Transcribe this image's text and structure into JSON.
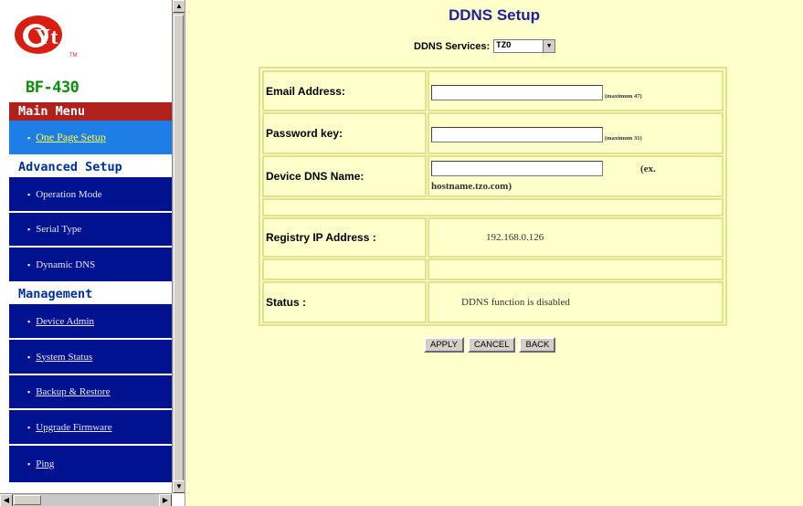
{
  "sidebar": {
    "logo_text": "Yt",
    "logo_tm": "TM",
    "model": "BF-430",
    "main_menu_title": "Main Menu",
    "one_page_setup": "One Page Setup",
    "advanced_title": "Advanced Setup",
    "advanced_items": [
      "Operation Mode",
      "Serial Type",
      "Dynamic DNS"
    ],
    "management_title": "Management",
    "management_items": [
      "Device Admin",
      "System Status",
      "Backup & Restore",
      "Upgrade Firmware",
      "Ping"
    ]
  },
  "page": {
    "title": "DDNS Setup",
    "services_label": "DDNS Services:",
    "services_value": "TZO"
  },
  "form": {
    "email_label": "Email Address:",
    "email_value": "",
    "email_hint": "(maximum 47)",
    "password_label": "Password key:",
    "password_value": "",
    "password_hint": "(maximum 31)",
    "dns_label": "Device DNS Name:",
    "dns_value": "",
    "dns_hint_ex": "(ex.",
    "dns_hint_host": "hostname.tzo.com)",
    "registry_label": "Registry IP Address :",
    "registry_value": "192.168.0.126",
    "status_label": "Status :",
    "status_value": "DDNS function is disabled"
  },
  "buttons": {
    "apply": "APPLY",
    "cancel": "CANCEL",
    "back": "BACK"
  },
  "colors": {
    "content_bg": "#ffffcc",
    "menu_bg": "#00128f",
    "main_menu_bg": "#b0201c",
    "active_item_bg": "#1f7de6",
    "title_color": "#20209a"
  }
}
